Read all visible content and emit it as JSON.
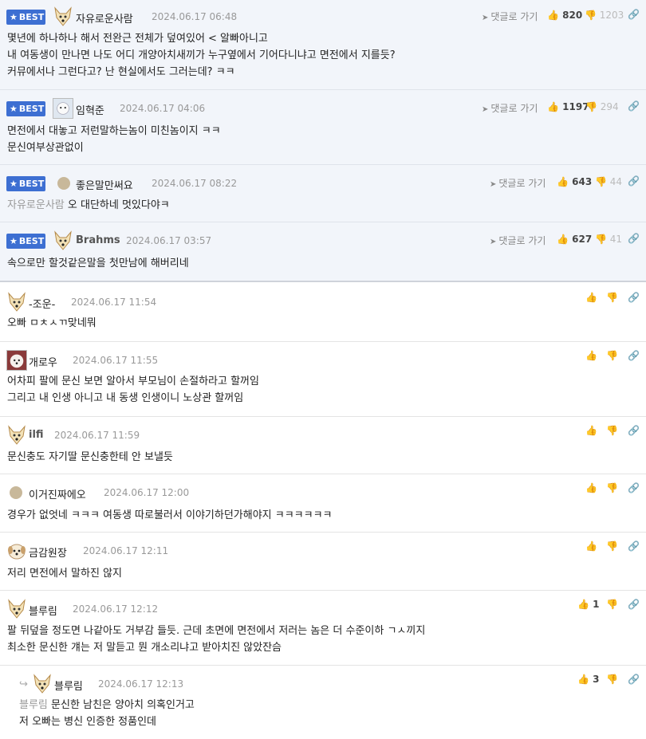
{
  "icons": {
    "best_star": "★",
    "thumb_up": "👍",
    "thumb_down": "👎",
    "link": "🔗",
    "go_arrow": "➤",
    "reply_arrow": "↪"
  },
  "colors": {
    "best_badge": "#3d6fd2",
    "best_bg": "#f2f5fa",
    "mention": "#999999",
    "date": "#999999"
  },
  "best_label": "BEST",
  "go_label": "댓글로 가기",
  "comments": [
    {
      "best": true,
      "nick": "자유로운사람",
      "date": "2024.06.17 06:48",
      "up": "820",
      "down": "1203",
      "avatar": "dog",
      "body": "몇년에 하나하나 해서 전완근 전체가 덮여있어 < 알빠아니고\n내 여동생이 만나면 나도 어디 개양아치새끼가 누구옆에서 기어다니냐고 면전에서 지를듯?\n커뮤에서나 그런다고? 난 현실에서도 그러는데? ㅋㅋ"
    },
    {
      "best": true,
      "nick": "임혁준",
      "date": "2024.06.17 04:06",
      "up": "1197",
      "down": "294",
      "avatar": "photo",
      "body": "면전에서 대놓고 저런말하는놈이 미친놈이지 ㅋㅋ\n문신여부상관없이"
    },
    {
      "best": true,
      "nick": "좋은말만써요",
      "date": "2024.06.17 08:22",
      "up": "643",
      "down": "44",
      "avatar": "dot",
      "mention": "자유로운사람",
      "body": "오 대단하네 멋있다야ㅋ"
    },
    {
      "best": true,
      "nick": "Brahms",
      "date": "2024.06.17 03:57",
      "up": "627",
      "down": "41",
      "avatar": "dog",
      "body": "속으로만 할것같은말을 첫만남에 해버리네"
    },
    {
      "best": false,
      "nick": "-조운-",
      "date": "2024.06.17 11:54",
      "up": "",
      "down": "",
      "avatar": "dog",
      "body": "오빠 ㅁㅊㅅㄲ맞네뭐"
    },
    {
      "best": false,
      "nick": "개로우",
      "date": "2024.06.17 11:55",
      "up": "",
      "down": "",
      "avatar": "photo",
      "body": "어차피 팔에 문신 보면 알아서 부모님이 손절하라고 할꺼임\n그리고 내 인생 아니고 내 동생 인생이니 노상관 할꺼임"
    },
    {
      "best": false,
      "nick": "ilfi",
      "date": "2024.06.17 11:59",
      "up": "",
      "down": "",
      "avatar": "dog",
      "body": "문신충도 자기딸 문신충한테 안 보낼듯"
    },
    {
      "best": false,
      "nick": "이거진짜에오",
      "date": "2024.06.17 12:00",
      "up": "",
      "down": "",
      "avatar": "dot",
      "body": "경우가 없엇네 ㅋㅋㅋ 여동생 따로불러서 이야기하던가해야지 ㅋㅋㅋㅋㅋㅋ"
    },
    {
      "best": false,
      "nick": "금감원장",
      "date": "2024.06.17 12:11",
      "up": "",
      "down": "",
      "avatar": "puppy",
      "body": "저리 면전에서 말하진 않지"
    },
    {
      "best": false,
      "nick": "블루림",
      "date": "2024.06.17 12:12",
      "up": "1",
      "down": "",
      "avatar": "dog",
      "body": "팔 뒤덮을 정도면 나같아도 거부감 들듯. 근데 초면에 면전에서 저러는 놈은 더 수준이하 ㄱㅅ끼지\n최소한 문신한 걔는 저 말듣고 뭔 개소리냐고 받아치진 않았잔슴"
    },
    {
      "best": false,
      "reply": true,
      "nick": "블루림",
      "date": "2024.06.17 12:13",
      "up": "3",
      "down": "",
      "avatar": "dog",
      "mention": "블루림",
      "body": "문신한 남친은 양아치 의혹인거고\n저 오빠는 병신 인증한 정품인데"
    }
  ]
}
